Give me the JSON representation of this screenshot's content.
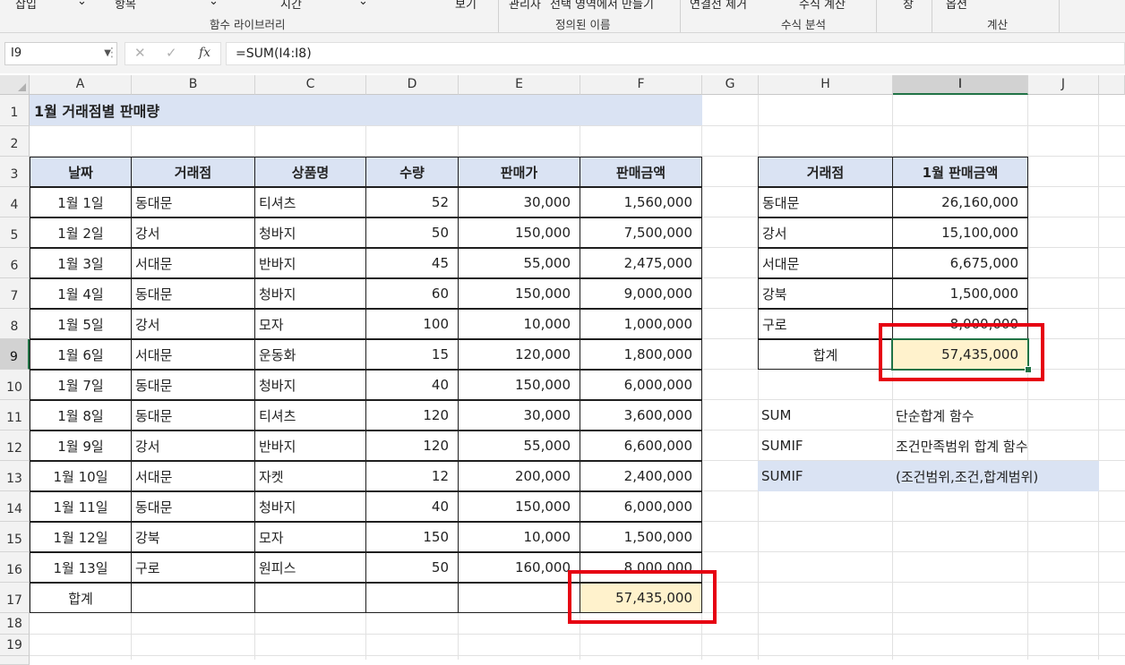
{
  "ribbon": {
    "top_items": [
      "삽입",
      "항목",
      "시간",
      "보기",
      "관리자",
      "선택 영역에서 만들기",
      "연결선 제거",
      "수식 계산",
      "창",
      "옵션"
    ],
    "groups": [
      "함수 라이브러리",
      "정의된 이름",
      "수식 분석",
      "계산"
    ]
  },
  "name_box": "I9",
  "formula": "=SUM(I4:I8)",
  "columns": [
    "A",
    "B",
    "C",
    "D",
    "E",
    "F",
    "G",
    "H",
    "I",
    "J"
  ],
  "rows": [
    "1",
    "2",
    "3",
    "4",
    "5",
    "6",
    "7",
    "8",
    "9",
    "10",
    "11",
    "12",
    "13",
    "14",
    "15",
    "16",
    "17",
    "18",
    "19"
  ],
  "title": "1월 거래점별 판매량",
  "main_table": {
    "headers": [
      "날짜",
      "거래점",
      "상품명",
      "수량",
      "판매가",
      "판매금액"
    ],
    "rows": [
      [
        "1월 1일",
        "동대문",
        "티셔츠",
        "52",
        "30,000",
        "1,560,000"
      ],
      [
        "1월 2일",
        "강서",
        "청바지",
        "50",
        "150,000",
        "7,500,000"
      ],
      [
        "1월 3일",
        "서대문",
        "반바지",
        "45",
        "55,000",
        "2,475,000"
      ],
      [
        "1월 4일",
        "동대문",
        "청바지",
        "60",
        "150,000",
        "9,000,000"
      ],
      [
        "1월 5일",
        "강서",
        "모자",
        "100",
        "10,000",
        "1,000,000"
      ],
      [
        "1월 6일",
        "서대문",
        "운동화",
        "15",
        "120,000",
        "1,800,000"
      ],
      [
        "1월 7일",
        "동대문",
        "청바지",
        "40",
        "150,000",
        "6,000,000"
      ],
      [
        "1월 8일",
        "동대문",
        "티셔츠",
        "120",
        "30,000",
        "3,600,000"
      ],
      [
        "1월 9일",
        "강서",
        "반바지",
        "120",
        "55,000",
        "6,600,000"
      ],
      [
        "1월 10일",
        "서대문",
        "자켓",
        "12",
        "200,000",
        "2,400,000"
      ],
      [
        "1월 11일",
        "동대문",
        "청바지",
        "40",
        "150,000",
        "6,000,000"
      ],
      [
        "1월 12일",
        "강북",
        "모자",
        "150",
        "10,000",
        "1,500,000"
      ],
      [
        "1월 13일",
        "구로",
        "원피스",
        "50",
        "160,000",
        "8,000,000"
      ]
    ],
    "total_label": "합계",
    "total_value": "57,435,000"
  },
  "summary_table": {
    "headers": [
      "거래점",
      "1월 판매금액"
    ],
    "rows": [
      [
        "동대문",
        "26,160,000"
      ],
      [
        "강서",
        "15,100,000"
      ],
      [
        "서대문",
        "6,675,000"
      ],
      [
        "강북",
        "1,500,000"
      ],
      [
        "구로",
        "8,000,000"
      ]
    ],
    "total_label": "합계",
    "total_value": "57,435,000"
  },
  "notes": [
    [
      "SUM",
      "단순합계 함수"
    ],
    [
      "SUMIF",
      "조건만족범위 합계 함수"
    ],
    [
      "SUMIF",
      "(조건범위,조건,합계범위)"
    ]
  ],
  "colors": {
    "header_fill": "#dae3f3",
    "total_fill": "#fff2cc",
    "highlight_box": "#e60012",
    "selection": "#217346"
  }
}
